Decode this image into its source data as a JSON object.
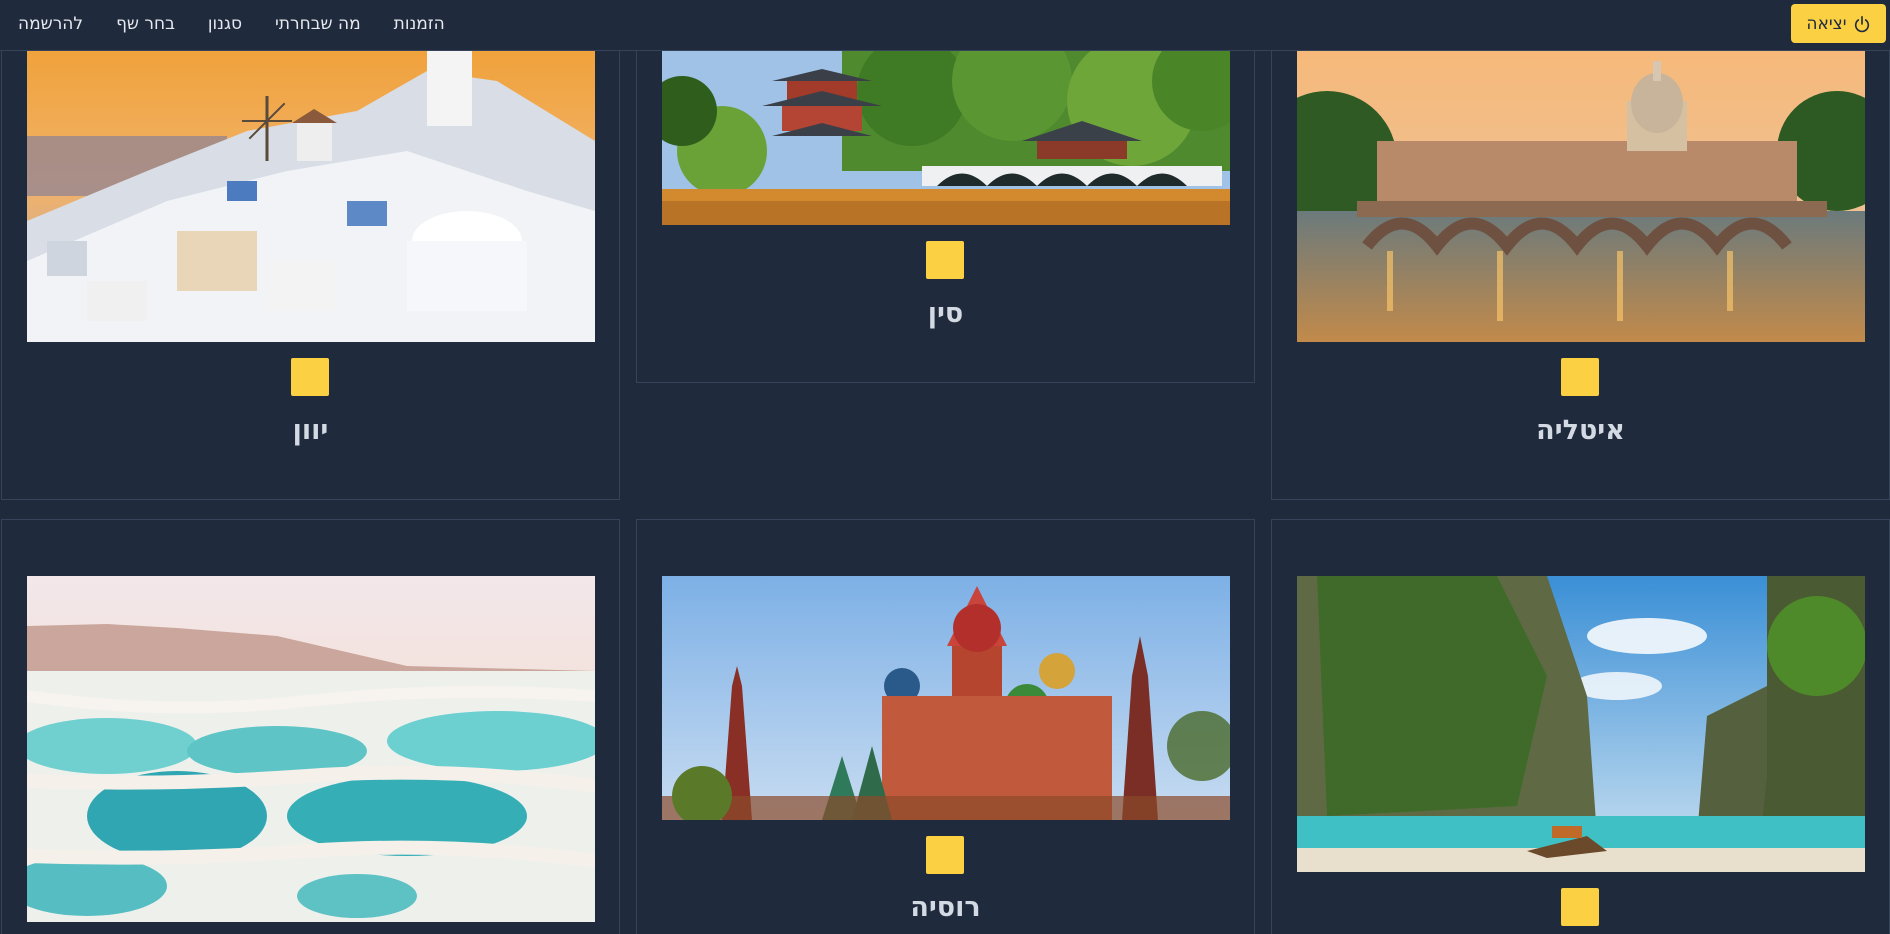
{
  "nav": {
    "logout_label": "יציאה",
    "logout_icon": "power-icon",
    "links": [
      "להרשמה",
      "בחר שף",
      "סגנון",
      "מה שבחרתי",
      "הזמנות"
    ]
  },
  "colors": {
    "background": "#1f2a3c",
    "accent": "#fbd143",
    "border": "#36435a",
    "text": "#d4dae3"
  },
  "destinations": [
    {
      "name": "יוון",
      "image": "santorini-village-sunset"
    },
    {
      "name": "סין",
      "image": "chinese-pagoda-bridge"
    },
    {
      "name": "איטליה",
      "image": "rome-st-peters-bridge"
    },
    {
      "name": "",
      "image": "dead-sea-salt-pools"
    },
    {
      "name": "רוסיה",
      "image": "st-basils-cathedral"
    },
    {
      "name": "",
      "image": "thailand-limestone-beach"
    }
  ]
}
